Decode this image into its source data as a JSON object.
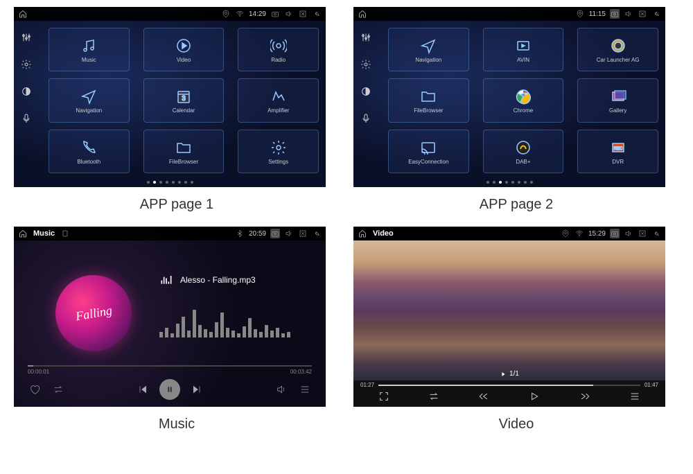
{
  "captions": {
    "app1": "APP page 1",
    "app2": "APP page 2",
    "music": "Music",
    "video": "Video"
  },
  "app1": {
    "time": "14:29",
    "apps": [
      {
        "label": "Music",
        "icon": "music"
      },
      {
        "label": "Video",
        "icon": "play-circle"
      },
      {
        "label": "Radio",
        "icon": "radio"
      },
      {
        "label": "Navigation",
        "icon": "nav"
      },
      {
        "label": "Calendar",
        "icon": "calendar",
        "badge": "3"
      },
      {
        "label": "Amplifier",
        "icon": "amplifier"
      },
      {
        "label": "Bluetooth",
        "icon": "phone"
      },
      {
        "label": "FileBrowser",
        "icon": "folder"
      },
      {
        "label": "Settings",
        "icon": "settings"
      }
    ],
    "pageDots": 8,
    "activeDot": 1
  },
  "app2": {
    "time": "11:15",
    "apps": [
      {
        "label": "Navigation",
        "icon": "nav"
      },
      {
        "label": "AVIN",
        "icon": "avin"
      },
      {
        "label": "Car Launcher AG",
        "icon": "launcher"
      },
      {
        "label": "FileBrowser",
        "icon": "folder"
      },
      {
        "label": "Chrome",
        "icon": "chrome"
      },
      {
        "label": "Gallery",
        "icon": "gallery"
      },
      {
        "label": "EasyConnection",
        "icon": "cast"
      },
      {
        "label": "DAB+",
        "icon": "dab"
      },
      {
        "label": "DVR",
        "icon": "dvr"
      }
    ],
    "pageDots": 8,
    "activeDot": 2
  },
  "music": {
    "title": "Music",
    "time": "20:59",
    "album_text": "Falling",
    "song": "Alesso - Falling.mp3",
    "elapsed": "00:00:01",
    "total": "00:03:42"
  },
  "video": {
    "title": "Video",
    "time": "15:29",
    "elapsed": "01:27",
    "total": "01:47",
    "count": "1/1"
  }
}
